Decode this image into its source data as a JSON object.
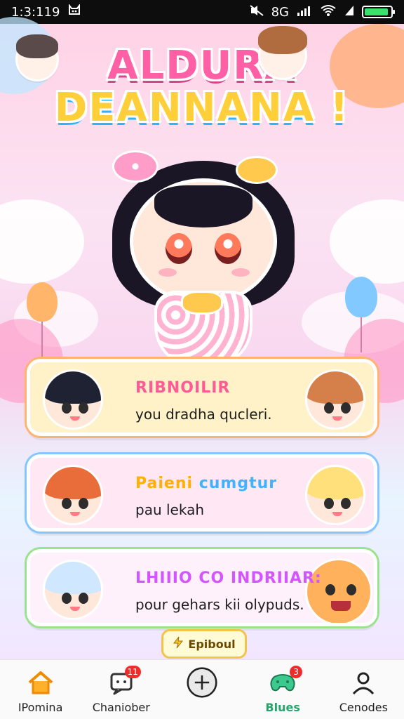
{
  "status": {
    "time": "1:3:119",
    "network": "8G",
    "battery_level": 0.92
  },
  "app": {
    "title_line1": "ALDURA",
    "title_line2": "DEANNANA !"
  },
  "cards": [
    {
      "title": "RIBNOILIR",
      "subtitle": "you dradha qucleri.",
      "left_avatar_hair": "#1f2232",
      "right_avatar_hair": "#d5804b",
      "bg": "#fff2c9",
      "outline": "#ffb36b",
      "title_color": "#ff5a96"
    },
    {
      "title_part1": "Paieni",
      "title_part2": "cumgtur",
      "subtitle": "pau lekah",
      "left_avatar_hair": "#e86d3a",
      "right_avatar_hair": "#ffe07a",
      "bg": "#ffe7f3",
      "outline": "#86c6ff",
      "title_color": "#ffb100",
      "title_color2": "#3db4ff"
    },
    {
      "title": "LHIIIO CO INDRIIAR:",
      "subtitle": "pour gehars kii olypuds.",
      "left_avatar_hair": "#cfe8ff",
      "bg": "#fff1fb",
      "outline": "#9be28f",
      "title_color": "#d455ff"
    }
  ],
  "chip": {
    "label": "Epiboul"
  },
  "nav": {
    "items": [
      {
        "label": "IPomina",
        "icon": "home-icon"
      },
      {
        "label": "Chaniober",
        "icon": "chat-icon",
        "badge": "11"
      },
      {
        "label": "",
        "icon": "plus-circle-icon"
      },
      {
        "label": "Blues",
        "icon": "gamepad-icon",
        "badge": "3"
      },
      {
        "label": "Cenodes",
        "icon": "user-icon"
      }
    ]
  }
}
